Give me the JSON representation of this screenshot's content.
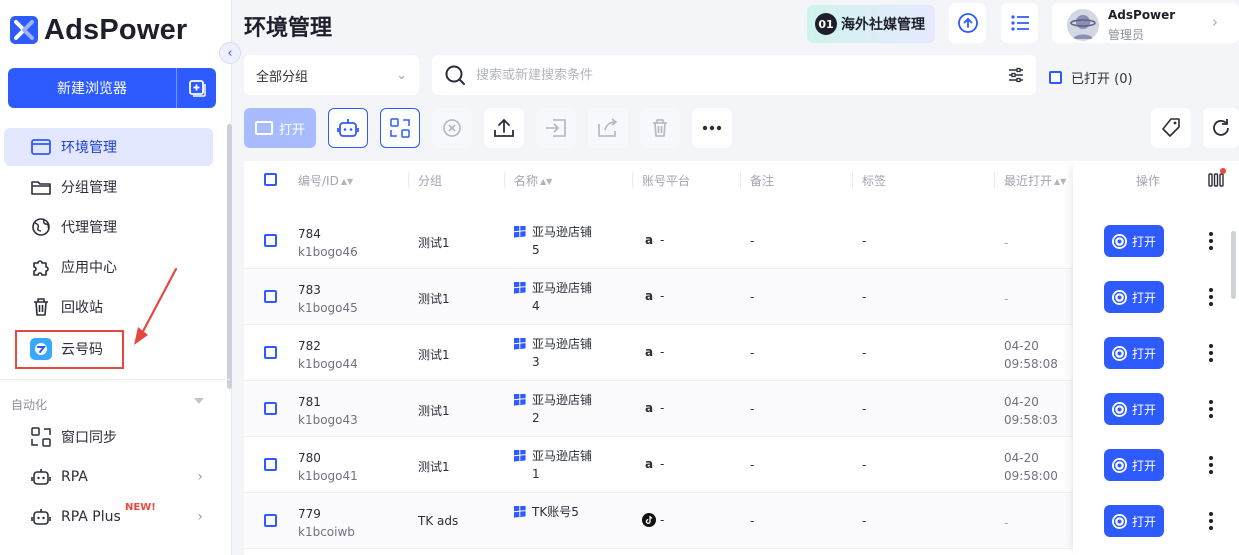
{
  "app": {
    "name": "AdsPower"
  },
  "sidebar": {
    "new_browser_label": "新建浏览器",
    "items": [
      {
        "label": "环境管理",
        "icon": "browser-window-icon",
        "active": true
      },
      {
        "label": "分组管理",
        "icon": "folder-icon"
      },
      {
        "label": "代理管理",
        "icon": "globe-icon"
      },
      {
        "label": "应用中心",
        "icon": "puzzle-icon"
      },
      {
        "label": "回收站",
        "icon": "trash-icon"
      },
      {
        "label": "云号码",
        "icon": "cloud-number-icon"
      }
    ],
    "section_title": "自动化",
    "automation_items": [
      {
        "label": "窗口同步",
        "icon": "window-sync-icon"
      },
      {
        "label": "RPA",
        "icon": "robot-icon"
      },
      {
        "label": "RPA Plus",
        "icon": "robot-icon",
        "badge": "NEW!"
      }
    ]
  },
  "header": {
    "title": "环境管理",
    "promo_label": "海外社媒管理",
    "user_name": "AdsPower",
    "user_role": "管理员"
  },
  "filters": {
    "group_select": "全部分组",
    "search_placeholder": "搜索或新建搜索条件",
    "opened_label": "已打开 (0)"
  },
  "toolbar": {
    "open_label": "打开"
  },
  "table": {
    "headers": {
      "id": "编号/ID",
      "group": "分组",
      "name": "名称",
      "platform": "账号平台",
      "note": "备注",
      "tag": "标签",
      "last_open": "最近打开",
      "action": "操作"
    },
    "rows": [
      {
        "no": "784",
        "id": "k1bogo46",
        "group": "测试1",
        "name1": "亚马逊店铺",
        "name2": "5",
        "platform": "amazon",
        "platform_text": "-",
        "note": "-",
        "tag": "-",
        "last1": "-",
        "last2": "",
        "btn": "打开"
      },
      {
        "no": "783",
        "id": "k1bogo45",
        "group": "测试1",
        "name1": "亚马逊店铺",
        "name2": "4",
        "platform": "amazon",
        "platform_text": "-",
        "note": "-",
        "tag": "-",
        "last1": "-",
        "last2": "",
        "btn": "打开"
      },
      {
        "no": "782",
        "id": "k1bogo44",
        "group": "测试1",
        "name1": "亚马逊店铺",
        "name2": "3",
        "platform": "amazon",
        "platform_text": "-",
        "note": "-",
        "tag": "-",
        "last1": "04-20",
        "last2": "09:58:08",
        "btn": "打开"
      },
      {
        "no": "781",
        "id": "k1bogo43",
        "group": "测试1",
        "name1": "亚马逊店铺",
        "name2": "2",
        "platform": "amazon",
        "platform_text": "-",
        "note": "-",
        "tag": "-",
        "last1": "04-20",
        "last2": "09:58:03",
        "btn": "打开"
      },
      {
        "no": "780",
        "id": "k1bogo41",
        "group": "测试1",
        "name1": "亚马逊店铺",
        "name2": "1",
        "platform": "amazon",
        "platform_text": "-",
        "note": "-",
        "tag": "-",
        "last1": "04-20",
        "last2": "09:58:00",
        "btn": "打开"
      },
      {
        "no": "779",
        "id": "k1bcoiwb",
        "group": "TK ads",
        "name1": "TK账号5",
        "name2": "",
        "platform": "tiktok",
        "platform_text": "-",
        "note": "-",
        "tag": "-",
        "last1": "-",
        "last2": "",
        "btn": "打开"
      }
    ]
  },
  "colors": {
    "primary": "#2e5bff",
    "highlight_box": "#e5483f",
    "new_badge": "#f0473a"
  }
}
